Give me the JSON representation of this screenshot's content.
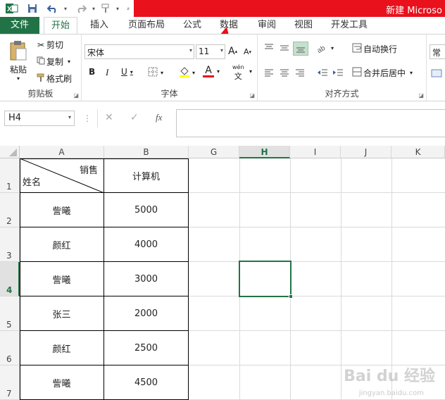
{
  "window": {
    "title": "新建 Microso"
  },
  "quick_access": {
    "excel_icon": "excel-logo-icon",
    "save": "save-icon",
    "undo": "undo-icon",
    "redo": "redo-icon",
    "brush": "format-brush-icon"
  },
  "tabs": [
    {
      "label": "文件"
    },
    {
      "label": "开始"
    },
    {
      "label": "插入"
    },
    {
      "label": "页面布局"
    },
    {
      "label": "公式"
    },
    {
      "label": "数据"
    },
    {
      "label": "审阅"
    },
    {
      "label": "视图"
    },
    {
      "label": "开发工具"
    }
  ],
  "clipboard": {
    "paste": "粘贴",
    "cut": "剪切",
    "copy": "复制",
    "format_painter": "格式刷",
    "label": "剪贴板"
  },
  "font": {
    "name": "宋体",
    "size": "11",
    "grow": "A",
    "shrink": "A",
    "bold": "B",
    "italic": "I",
    "underline": "U",
    "font_color": "A",
    "wen": "wén",
    "label": "字体"
  },
  "alignment": {
    "wrap": "自动换行",
    "merge": "合并后居中",
    "label": "对齐方式"
  },
  "number": {
    "format": "常规"
  },
  "formula_bar": {
    "namebox": "H4",
    "fx": "fx",
    "cancel": "✕",
    "enter": "✓",
    "value": ""
  },
  "sheet": {
    "columns": [
      "A",
      "B",
      "G",
      "H",
      "I",
      "J",
      "K"
    ],
    "rows": [
      "1",
      "2",
      "3",
      "4",
      "5",
      "6",
      "7"
    ],
    "header": {
      "diag_top": "销售",
      "diag_bottom": "姓名",
      "b1": "计算机"
    },
    "data": [
      {
        "name": "訾曦",
        "value": "5000"
      },
      {
        "name": "颜红",
        "value": "4000"
      },
      {
        "name": "訾曦",
        "value": "3000"
      },
      {
        "name": "张三",
        "value": "2000"
      },
      {
        "name": "颜红",
        "value": "2500"
      },
      {
        "name": "訾曦",
        "value": "4500"
      }
    ],
    "selected_cell": "H4"
  },
  "colors": {
    "accent": "#217346",
    "title_red": "#e8111c",
    "arrow": "#e8111c"
  },
  "watermark": {
    "main": "Bai du 经验",
    "sub": "jingyan.baidu.com"
  }
}
